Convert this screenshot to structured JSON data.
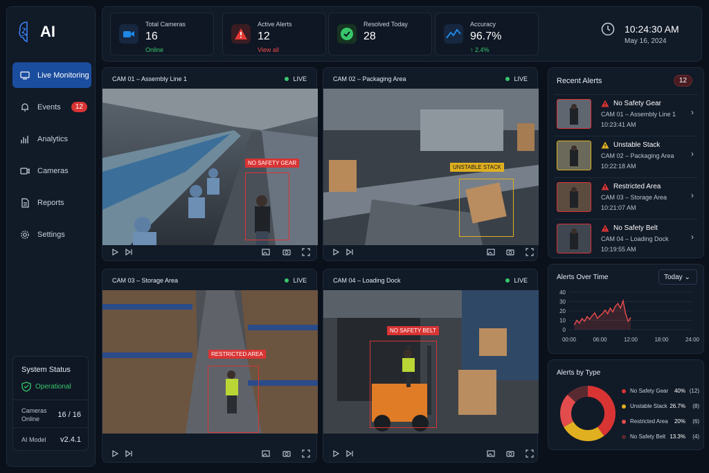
{
  "app": {
    "logo_text": "AI"
  },
  "nav": [
    {
      "label": "Live Monitoring",
      "icon": "monitor-icon",
      "active": true
    },
    {
      "label": "Events",
      "icon": "bell-icon",
      "badge": "12"
    },
    {
      "label": "Analytics",
      "icon": "bar-chart-icon"
    },
    {
      "label": "Cameras",
      "icon": "camera-icon"
    },
    {
      "label": "Reports",
      "icon": "document-icon"
    },
    {
      "label": "Settings",
      "icon": "gear-icon"
    }
  ],
  "system": {
    "title": "System Status",
    "status": "Operational",
    "cameras_label": "Cameras Online",
    "cameras_value": "16 / 16",
    "model_label": "AI Model",
    "model_value": "v2.4.1"
  },
  "kpis": [
    {
      "label": "Total Cameras",
      "value": "16",
      "sub": "Online",
      "color": "#1e88e5",
      "sub_color": "#38c76b"
    },
    {
      "label": "Active Alerts",
      "value": "12",
      "sub": "View all",
      "color": "#d93434",
      "sub_color": "#ef4d4d"
    },
    {
      "label": "Resolved Today",
      "value": "28",
      "sub": "",
      "color": "#38c76b",
      "sub_color": "#38c76b"
    },
    {
      "label": "Accuracy",
      "value": "96.7%",
      "sub": "↑ 2.4%",
      "color": "#1e88e5",
      "sub_color": "#38c76b"
    }
  ],
  "clock": {
    "time": "10:24:30 AM",
    "date": "May 16, 2024"
  },
  "cameras": [
    {
      "title": "CAM 01 – Assembly Line 1",
      "live": "LIVE",
      "alert": "NO SAFETY GEAR",
      "alert_color": "#d93434"
    },
    {
      "title": "CAM 02 – Packaging Area",
      "live": "LIVE",
      "alert": "UNSTABLE STACK",
      "alert_color": "#e0b020"
    },
    {
      "title": "CAM 03 – Storage Area",
      "live": "LIVE",
      "alert": "RESTRICTED AREA",
      "alert_color": "#d93434"
    },
    {
      "title": "CAM 04 – Loading Dock",
      "live": "LIVE",
      "alert": "NO SAFETY BELT",
      "alert_color": "#d93434"
    }
  ],
  "recent_alerts": {
    "title": "Recent Alerts",
    "count": "12",
    "items": [
      {
        "title": "No Safety Gear",
        "camera": "CAM 01 – Assembly Line 1",
        "time": "10:23:41 AM",
        "color": "#d93434"
      },
      {
        "title": "Unstable Stack",
        "camera": "CAM 02 – Packaging Area",
        "time": "10:22:18 AM",
        "color": "#e0b020"
      },
      {
        "title": "Restricted Area",
        "camera": "CAM 03 – Storage Area",
        "time": "10:21:07 AM",
        "color": "#d93434"
      },
      {
        "title": "No Safety Belt",
        "camera": "CAM 04 – Loading Dock",
        "time": "10:19:55 AM",
        "color": "#d93434"
      }
    ]
  },
  "over_time": {
    "title": "Alerts Over Time",
    "range": "Today ⌄"
  },
  "by_type": {
    "title": "Alerts by Type"
  },
  "chart_data": [
    {
      "type": "line",
      "title": "Alerts Over Time",
      "x": [
        "00:00",
        "06:00",
        "12:00",
        "18:00",
        "24:00"
      ],
      "ylim": [
        0,
        40
      ],
      "yticks": [
        0,
        10,
        20,
        30,
        40
      ],
      "series": [
        {
          "points": [
            [
              1,
              5
            ],
            [
              1.5,
              10
            ],
            [
              2,
              7
            ],
            [
              2.5,
              12
            ],
            [
              3,
              9
            ],
            [
              3.5,
              14
            ],
            [
              4,
              11
            ],
            [
              4.5,
              15
            ],
            [
              5,
              18
            ],
            [
              5.5,
              12
            ],
            [
              6,
              15
            ],
            [
              6.5,
              17
            ],
            [
              7,
              21
            ],
            [
              7.5,
              17
            ],
            [
              8,
              23
            ],
            [
              8.5,
              19
            ],
            [
              9,
              25
            ],
            [
              9.5,
              28
            ],
            [
              10,
              23
            ],
            [
              10.5,
              31
            ],
            [
              11,
              17
            ],
            [
              11.5,
              9
            ],
            [
              12,
              13
            ]
          ],
          "color": "#ef4d4d"
        }
      ]
    },
    {
      "type": "pie",
      "title": "Alerts by Type",
      "series": [
        {
          "name": "No Safety Gear",
          "percent": "40%",
          "count": "(12)",
          "value": 40,
          "color": "#d93434"
        },
        {
          "name": "Unstable Stack",
          "percent": "26.7%",
          "count": "(8)",
          "value": 26.7,
          "color": "#e0b020"
        },
        {
          "name": "Restricted Area",
          "percent": "20%",
          "count": "(6)",
          "value": 20,
          "color": "#e34c4c"
        },
        {
          "name": "No Safety Belt",
          "percent": "13.3%",
          "count": "(4)",
          "value": 13.3,
          "color": "#5a2a31"
        }
      ]
    }
  ]
}
